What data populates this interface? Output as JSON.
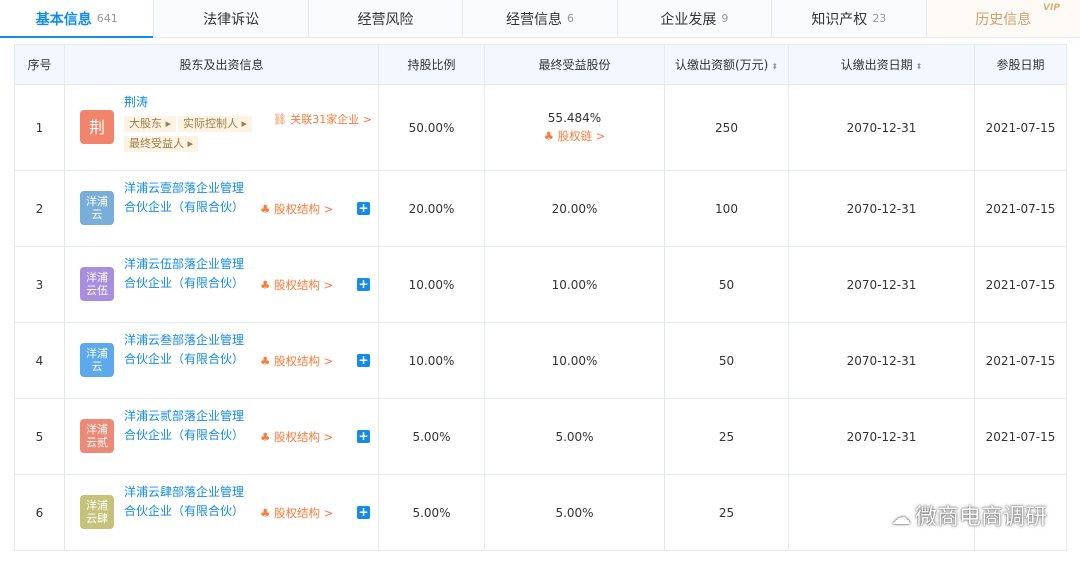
{
  "tabs": [
    {
      "label": "基本信息",
      "count": "641"
    },
    {
      "label": "法律诉讼",
      "count": ""
    },
    {
      "label": "经营风险",
      "count": ""
    },
    {
      "label": "经营信息",
      "count": "6"
    },
    {
      "label": "企业发展",
      "count": "9"
    },
    {
      "label": "知识产权",
      "count": "23"
    },
    {
      "label": "历史信息",
      "count": "",
      "badge": "VIP"
    }
  ],
  "table": {
    "headers": {
      "index": "序号",
      "shareholder": "股东及出资信息",
      "ratio": "持股比例",
      "ubo": "最终受益股份",
      "amount": "认缴出资额(万元)",
      "date": "认缴出资日期",
      "join": "参股日期"
    },
    "rows": [
      {
        "index": "1",
        "logo": "荆",
        "logo_color": "#f0856b",
        "name": "荆涛",
        "tags": [
          "大股东",
          "实际控制人",
          "最终受益人"
        ],
        "related": "关联31家企业 >",
        "ratio": "50.00%",
        "ubo": "55.484%",
        "ubo_link": "股权链 >",
        "amount": "250",
        "date": "2070-12-31",
        "join": "2021-07-15"
      },
      {
        "index": "2",
        "logo": "洋浦云",
        "logo_color": "#79aedb",
        "name": "洋浦云壹部落企业管理合伙企业（有限合伙）",
        "equity": "股权结构 >",
        "ratio": "20.00%",
        "ubo": "20.00%",
        "amount": "100",
        "date": "2070-12-31",
        "join": "2021-07-15"
      },
      {
        "index": "3",
        "logo": "洋浦云伍",
        "logo_color": "#a98ee0",
        "name": "洋浦云伍部落企业管理合伙企业（有限合伙）",
        "equity": "股权结构 >",
        "ratio": "10.00%",
        "ubo": "10.00%",
        "amount": "50",
        "date": "2070-12-31",
        "join": "2021-07-15"
      },
      {
        "index": "4",
        "logo": "洋浦云",
        "logo_color": "#5ca9ee",
        "name": "洋浦云叁部落企业管理合伙企业（有限合伙）",
        "equity": "股权结构 >",
        "ratio": "10.00%",
        "ubo": "10.00%",
        "amount": "50",
        "date": "2070-12-31",
        "join": "2021-07-15"
      },
      {
        "index": "5",
        "logo": "洋浦云贰",
        "logo_color": "#ec8a78",
        "name": "洋浦云贰部落企业管理合伙企业（有限合伙）",
        "equity": "股权结构 >",
        "ratio": "5.00%",
        "ubo": "5.00%",
        "amount": "25",
        "date": "2070-12-31",
        "join": "2021-07-15"
      },
      {
        "index": "6",
        "logo": "洋浦云肆",
        "logo_color": "#c5c37a",
        "name": "洋浦云肆部落企业管理合伙企业（有限合伙）",
        "equity": "股权结构 >",
        "ratio": "5.00%",
        "ubo": "5.00%",
        "amount": "25",
        "date": "",
        "join": ""
      }
    ]
  },
  "watermark": "微商电商调研"
}
